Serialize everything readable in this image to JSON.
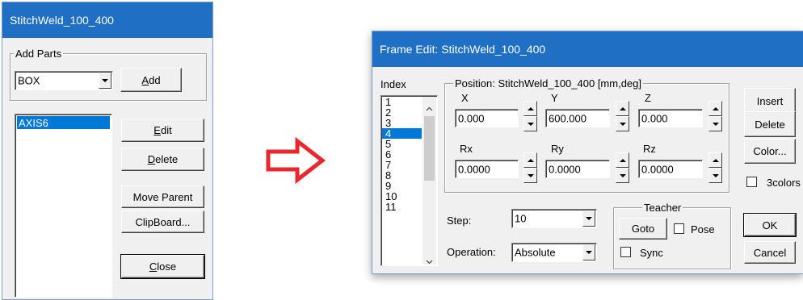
{
  "left_window": {
    "title": "StitchWeld_100_400",
    "add_parts": {
      "group_label": "Add Parts",
      "part_type_value": "BOX",
      "add_label_mnemonic": "A",
      "add_label_rest": "dd"
    },
    "parts_list": [
      "AXIS6"
    ],
    "buttons": {
      "edit_mnemonic": "E",
      "edit_rest": "dit",
      "delete_mnemonic": "D",
      "delete_rest": "elete",
      "move_parent": "Move Parent",
      "clipboard": "ClipBoard...",
      "close_mnemonic": "C",
      "close_rest": "lose"
    }
  },
  "transition_arrow_color": "#e8282e",
  "frame_edit": {
    "title": "Frame Edit: StitchWeld_100_400",
    "index_label": "Index",
    "index_items": [
      "1",
      "2",
      "3",
      "4",
      "5",
      "6",
      "7",
      "8",
      "9",
      "10",
      "11"
    ],
    "selected_index": "4",
    "position_group_label": "Position: StitchWeld_100_400 [mm,deg]",
    "fields": {
      "x": {
        "label": "X",
        "value": "0.000"
      },
      "y": {
        "label": "Y",
        "value": "600.000"
      },
      "z": {
        "label": "Z",
        "value": "0.000"
      },
      "rx": {
        "label": "Rx",
        "value": "0.0000"
      },
      "ry": {
        "label": "Ry",
        "value": "0.0000"
      },
      "rz": {
        "label": "Rz",
        "value": "0.0000"
      }
    },
    "step_label": "Step:",
    "step_value": "10",
    "operation_label": "Operation:",
    "operation_value": "Absolute",
    "teacher_group_label": "Teacher",
    "goto_label": "Goto",
    "pose_label": "Pose",
    "sync_label": "Sync",
    "buttons": {
      "insert": "Insert",
      "delete": "Delete",
      "color": "Color...",
      "three_colors": "3colors",
      "ok": "OK",
      "cancel": "Cancel"
    }
  },
  "colors": {
    "title_bar": "#1f6fc5",
    "selection": "#0078d7",
    "window_bg": "#f0f0f0"
  }
}
